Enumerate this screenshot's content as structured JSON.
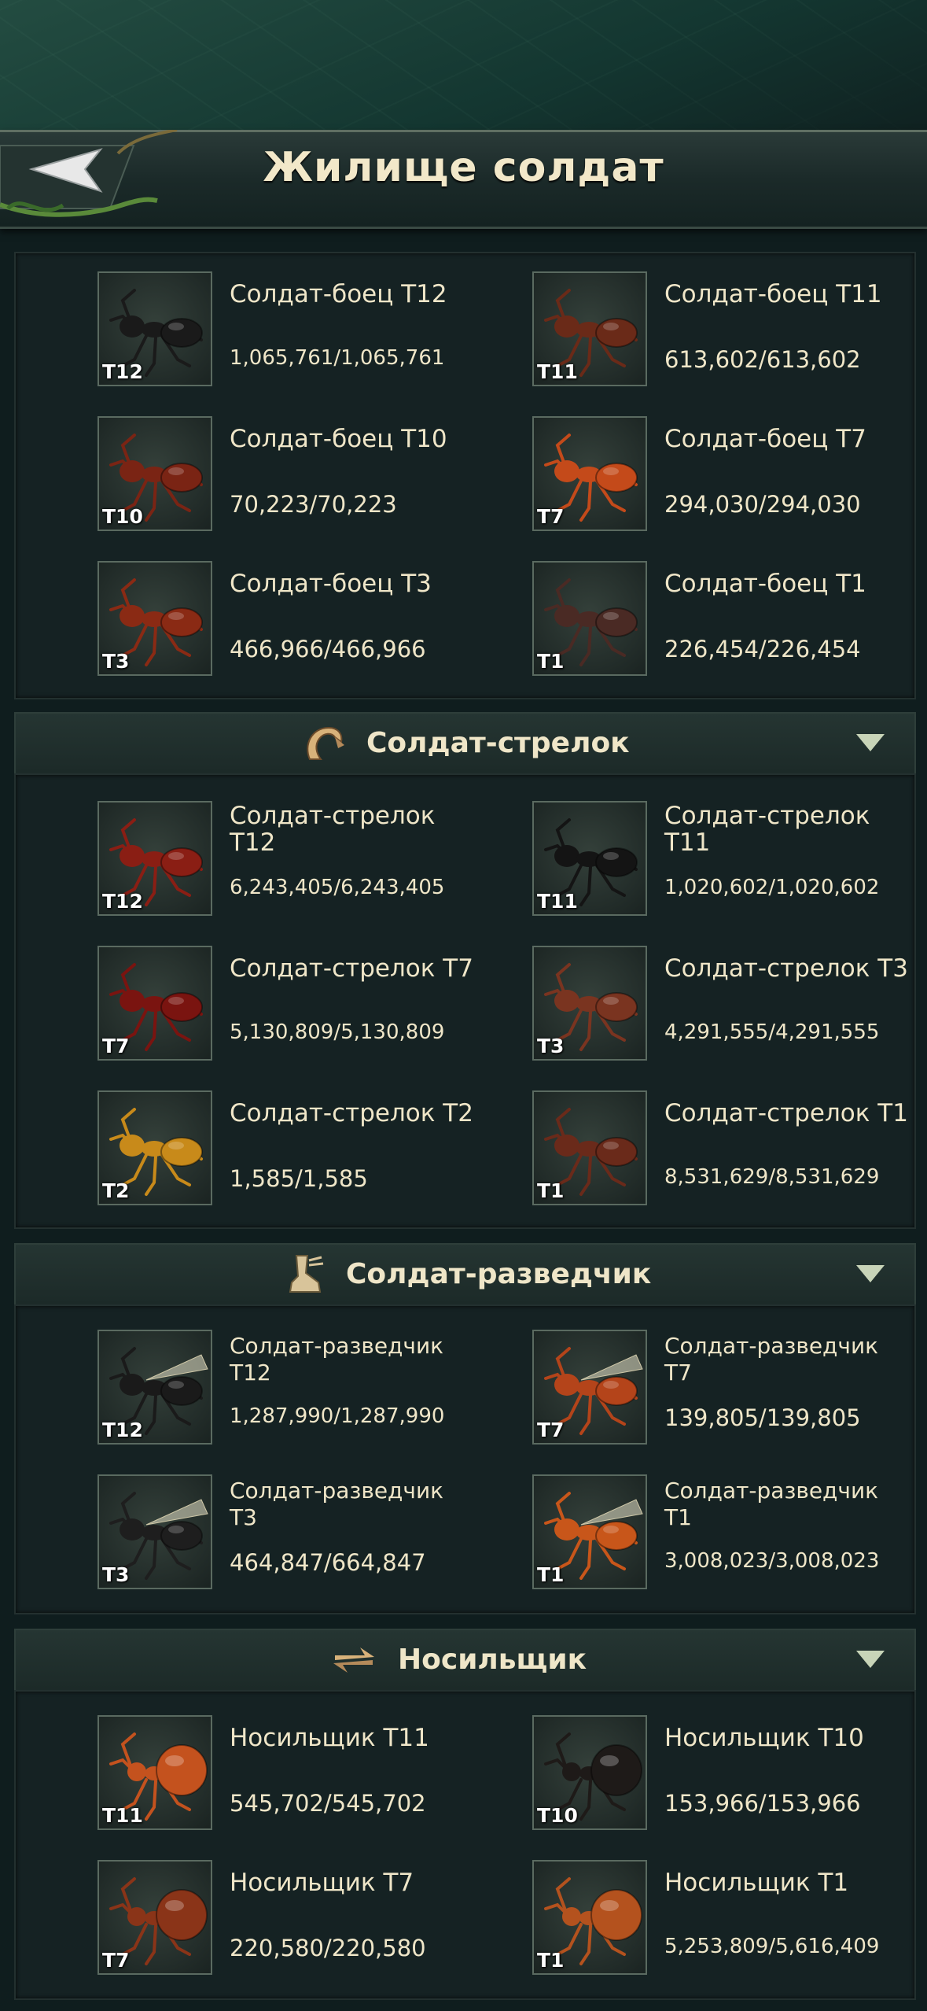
{
  "header": {
    "title": "Жилище солдат"
  },
  "sections": [
    {
      "title": "",
      "units": [
        {
          "name": "Солдат-боец T12",
          "tier": "T12",
          "count": "1,065,761/1,065,761",
          "color": "#1a1a1a"
        },
        {
          "name": "Солдат-боец T11",
          "tier": "T11",
          "count": "613,602/613,602",
          "color": "#6a2a18"
        },
        {
          "name": "Солдат-боец T10",
          "tier": "T10",
          "count": "70,223/70,223",
          "color": "#7a2414"
        },
        {
          "name": "Солдат-боец T7",
          "tier": "T7",
          "count": "294,030/294,030",
          "color": "#c44a1a"
        },
        {
          "name": "Солдат-боец T3",
          "tier": "T3",
          "count": "466,966/466,966",
          "color": "#8a2a14"
        },
        {
          "name": "Солдат-боец T1",
          "tier": "T1",
          "count": "226,454/226,454",
          "color": "#4a2a24"
        }
      ]
    },
    {
      "title": "Солдат-стрелок",
      "icon": "archer-claw-icon",
      "units": [
        {
          "name": "Солдат-стрелок T12",
          "tier": "T12",
          "count": "6,243,405/6,243,405",
          "color": "#8a1e14"
        },
        {
          "name": "Солдат-стрелок T11",
          "tier": "T11",
          "count": "1,020,602/1,020,602",
          "color": "#141414"
        },
        {
          "name": "Солдат-стрелок T7",
          "tier": "T7",
          "count": "5,130,809/5,130,809",
          "color": "#7a1410"
        },
        {
          "name": "Солдат-стрелок T3",
          "tier": "T3",
          "count": "4,291,555/4,291,555",
          "color": "#7a3420"
        },
        {
          "name": "Солдат-стрелок T2",
          "tier": "T2",
          "count": "1,585/1,585",
          "color": "#c88a1a"
        },
        {
          "name": "Солдат-стрелок T1",
          "tier": "T1",
          "count": "8,531,629/8,531,629",
          "color": "#6a2a1a"
        }
      ]
    },
    {
      "title": "Солдат-разведчик",
      "icon": "scout-boot-icon",
      "units": [
        {
          "name": "Солдат-разведчик T12",
          "tier": "T12",
          "count": "1,287,990/1,287,990",
          "color": "#1a1a1a"
        },
        {
          "name": "Солдат-разведчик T7",
          "tier": "T7",
          "count": "139,805/139,805",
          "color": "#b4441a"
        },
        {
          "name": "Солдат-разведчик T3",
          "tier": "T3",
          "count": "464,847/664,847",
          "color": "#1e1e1e"
        },
        {
          "name": "Солдат-разведчик T1",
          "tier": "T1",
          "count": "3,008,023/3,008,023",
          "color": "#c8561a"
        }
      ]
    },
    {
      "title": "Носильщик",
      "icon": "carrier-arrows-icon",
      "units": [
        {
          "name": "Носильщик T11",
          "tier": "T11",
          "count": "545,702/545,702",
          "color": "#c4521e"
        },
        {
          "name": "Носильщик T10",
          "tier": "T10",
          "count": "153,966/153,966",
          "color": "#1e1a18"
        },
        {
          "name": "Носильщик T7",
          "tier": "T7",
          "count": "220,580/220,580",
          "color": "#8a3418"
        },
        {
          "name": "Носильщик T1",
          "tier": "T1",
          "count": "5,253,809/5,616,409",
          "color": "#b4521e"
        }
      ]
    }
  ]
}
